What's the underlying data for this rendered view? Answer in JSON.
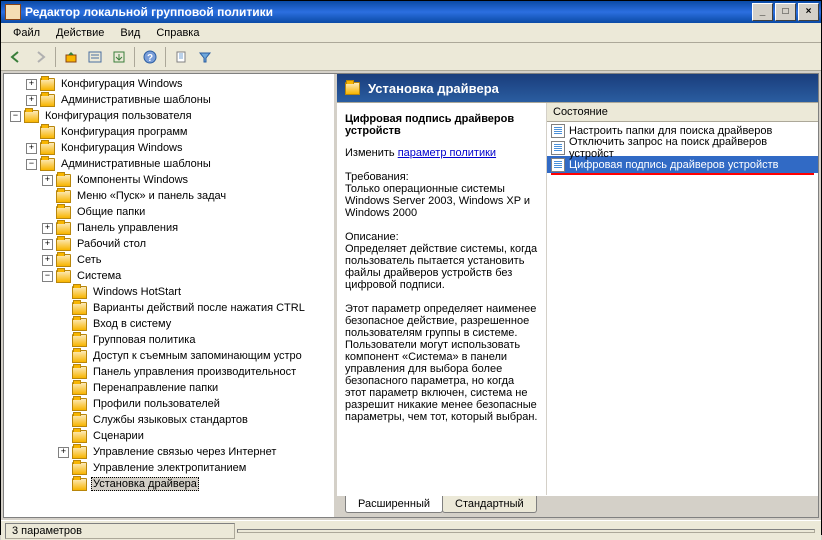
{
  "window": {
    "title": "Редактор локальной групповой политики",
    "min": "_",
    "max": "□",
    "close": "×"
  },
  "menu": {
    "file": "Файл",
    "action": "Действие",
    "view": "Вид",
    "help": "Справка"
  },
  "tree": {
    "n1": "Конфигурация Windows",
    "n2": "Административные шаблоны",
    "n3": "Конфигурация пользователя",
    "n4": "Конфигурация программ",
    "n5": "Конфигурация Windows",
    "n6": "Административные шаблоны",
    "n7": "Компоненты Windows",
    "n8": "Меню «Пуск» и панель задач",
    "n9": "Общие папки",
    "n10": "Панель управления",
    "n11": "Рабочий стол",
    "n12": "Сеть",
    "n13": "Система",
    "n14": "Windows HotStart",
    "n15": "Варианты действий после нажатия CTRL",
    "n16": "Вход в систему",
    "n17": "Групповая политика",
    "n18": "Доступ к съемным запоминающим устро",
    "n19": "Панель управления производительност",
    "n20": "Перенаправление папки",
    "n21": "Профили пользователей",
    "n22": "Службы языковых стандартов",
    "n23": "Сценарии",
    "n24": "Управление связью через Интернет",
    "n25": "Управление электропитанием",
    "n26": "Установка драйвера"
  },
  "detail": {
    "header": "Установка драйвера",
    "title": "Цифровая подпись драйверов устройств",
    "change": "Изменить",
    "paramlink": "параметр политики",
    "reqlabel": "Требования:",
    "reqtext": "Только операционные системы Windows Server 2003, Windows XP и Windows 2000",
    "desclabel": "Описание:",
    "desc1": "Определяет действие системы, когда пользователь пытается установить файлы драйверов устройств без цифровой подписи.",
    "desc2": "Этот параметр определяет наименее безопасное действие, разрешенное пользователям группы в системе. Пользователи могут использовать компонент «Система» в панели управления для выбора более безопасного параметра, но когда этот параметр включен, система не разрешит никакие менее безопасные параметры, чем тот, который выбран."
  },
  "list": {
    "header": "Состояние",
    "r1": "Настроить папки для поиска драйверов",
    "r2": "Отключить запрос на поиск драйверов устройст",
    "r3": "Цифровая подпись драйверов устройств"
  },
  "tabs": {
    "ext": "Расширенный",
    "std": "Стандартный"
  },
  "status": {
    "text": "3 параметров"
  }
}
